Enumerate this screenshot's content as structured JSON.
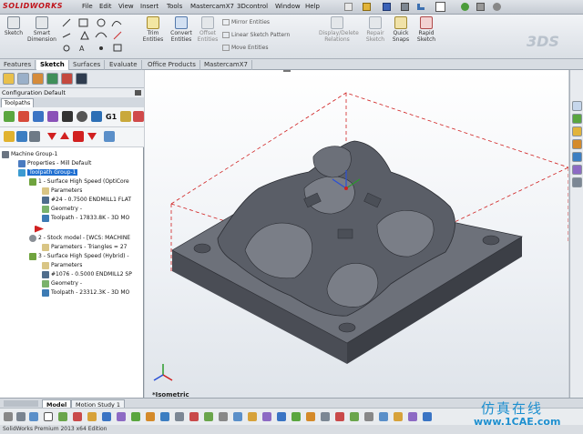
{
  "app": {
    "logo": "SOLIDWORKS",
    "menu": [
      "File",
      "Edit",
      "View",
      "Insert",
      "Tools",
      "MastercamX7",
      "3Dcontrol",
      "Window",
      "Help"
    ]
  },
  "commands": {
    "sketch": "Sketch",
    "smart_dimension": [
      "Smart",
      "Dimension"
    ],
    "trim": [
      "Trim",
      "Entities"
    ],
    "convert": [
      "Convert",
      "Entities"
    ],
    "offset": [
      "Offset",
      "Entities"
    ],
    "mirror": "Mirror Entities",
    "linear_pattern": "Linear Sketch Pattern",
    "move": "Move Entities",
    "display_delete": [
      "Display/Delete",
      "Relations"
    ],
    "repair": [
      "Repair",
      "Sketch"
    ],
    "quick_snaps": [
      "Quick",
      "Snaps"
    ],
    "rapid": [
      "Rapid",
      "Sketch"
    ]
  },
  "tabs": [
    "Features",
    "Sketch",
    "Surfaces",
    "Evaluate",
    "Office Products",
    "MastercamX7"
  ],
  "active_tab": "Sketch",
  "panel": {
    "configuration": "Configuration Default",
    "toolpaths_tab": "Toolpaths",
    "toolbar1_label": "G1",
    "tree": [
      {
        "label": "Machine Group-1",
        "level": 0
      },
      {
        "label": "Properties - Mill Default",
        "level": 1
      },
      {
        "label": "Toolpath Group-1",
        "level": 1,
        "selected": true
      },
      {
        "label": "1 - Surface High Speed (OptiCore",
        "level": 2
      },
      {
        "label": "Parameters",
        "level": 3
      },
      {
        "label": "#24 - 0.7500 ENDMILL1 FLAT",
        "level": 3
      },
      {
        "label": "Geometry -",
        "level": 3
      },
      {
        "label": "Toolpath - 17833.8K - 3D MO",
        "level": 3
      },
      {
        "label": "",
        "level": 2
      },
      {
        "label": "2 - Stock model - [WCS: MACHINE",
        "level": 2
      },
      {
        "label": "Parameters - Triangles = 27",
        "level": 3
      },
      {
        "label": "3 - Surface High Speed (Hybrid) -",
        "level": 2
      },
      {
        "label": "Parameters",
        "level": 3
      },
      {
        "label": "#1076 - 0.5000 ENDMILL2 SP",
        "level": 3
      },
      {
        "label": "Geometry -",
        "level": 3
      },
      {
        "label": "Toolpath - 23312.3K - 3D MO",
        "level": 3
      }
    ]
  },
  "viewport": {
    "view_label": "*Isometric"
  },
  "bottom_tabs": [
    "Model",
    "Motion Study 1"
  ],
  "status": "SolidWorks Premium 2013 x64 Edition",
  "watermark": {
    "line1": "仿真在线",
    "line2": "www.1CAE.com"
  },
  "colors": {
    "part": "#5d6069",
    "selection": "#1f6fd1",
    "bbox": "#d02020",
    "accent": "#c0141c"
  }
}
